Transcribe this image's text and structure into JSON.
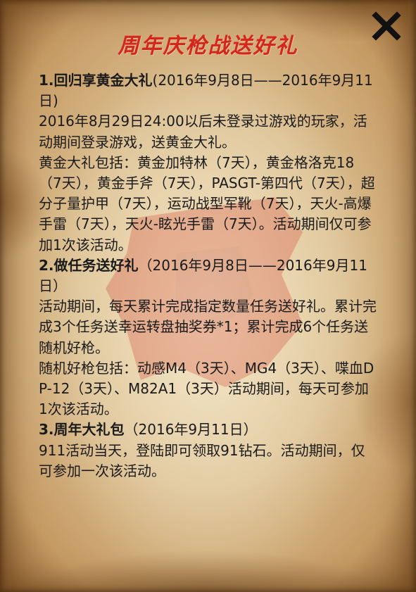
{
  "title": "周年庆枪战送好礼",
  "close_icon": "close-x-icon",
  "watermark_icon": "faded-game-logo",
  "colors": {
    "title": "#d4261b",
    "text": "#1a1a1a",
    "paper": "#dcc092"
  },
  "sections": [
    {
      "heading": "1.回归享黄金大礼",
      "date": "(2016年9月8日——2016年9月11日)",
      "lines": [
        "2016年8月29日24:00以后未登录过游戏的玩家，活动期间登录游戏，送黄金大礼。",
        "黄金大礼包括：黄金加特林（7天），黄金格洛克18（7天），黄金手斧（7天），PASGT-第四代（7天），超分子量护甲（7天），运动战型军靴（7天），天火-高爆手雷（7天），天火-眩光手雷（7天）。活动期间仅可参加1次该活动。"
      ]
    },
    {
      "heading": "2.做任务送好礼",
      "date": "（2016年9月8日——2016年9月11日）",
      "lines": [
        "活动期间，每天累计完成指定数量任务送好礼。累计完成3个任务送幸运转盘抽奖券*1；累计完成6个任务送随机好枪。",
        "随机好枪包括：动感M4（3天）、MG4（3天）、喋血DP-12（3天）、M82A1（3天）活动期间，每天可参加1次该活动。"
      ]
    },
    {
      "heading": "3.周年大礼包",
      "date": "（2016年9月11日）",
      "lines": [
        "911活动当天，登陆即可领取91钻石。活动期间，仅可参加一次该活动。"
      ]
    }
  ]
}
